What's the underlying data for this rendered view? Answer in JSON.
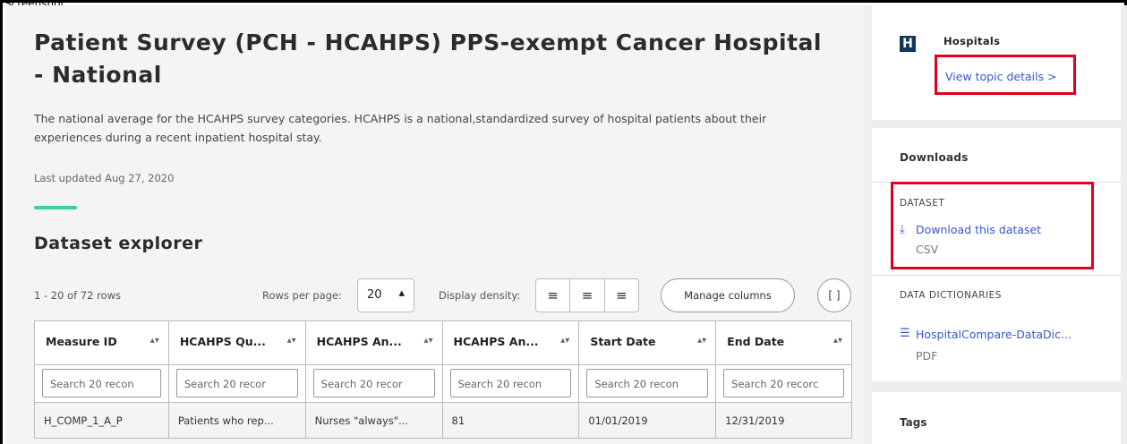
{
  "frame_label": "Screenshot",
  "page": {
    "title": "Patient Survey (PCH - HCAHPS) PPS-exempt Cancer Hospital - National",
    "description": "The national average for the HCAHPS survey categories. HCAHPS is a national,standardized survey of hospital patients about their experiences during a recent inpatient hospital stay.",
    "last_updated": "Last updated Aug 27, 2020"
  },
  "explorer": {
    "title": "Dataset explorer",
    "rows_info": "1 - 20 of 72 rows",
    "rows_per_page_label": "Rows per page:",
    "rows_per_page_value": "20",
    "density_label": "Display density:",
    "manage_columns_label": "Manage columns",
    "columns": [
      "Measure ID",
      "HCAHPS Qu...",
      "HCAHPS An...",
      "HCAHPS An...",
      "Start Date",
      "End Date"
    ],
    "search_placeholders": [
      "Search 20 recon",
      "Search 20 recor",
      "Search 20 recor",
      "Search 20 recon",
      "Search 20 recon",
      "Search 20 recorc"
    ],
    "rows": [
      [
        "H_COMP_1_A_P",
        "Patients who rep...",
        "Nurses \"always\"...",
        "81",
        "01/01/2019",
        "12/31/2019"
      ]
    ]
  },
  "sidebar": {
    "topic_icon_letter": "H",
    "topic_name": "Hospitals",
    "topic_link": "View topic details >",
    "downloads_title": "Downloads",
    "dataset_label": "DATASET",
    "download_link": "Download this dataset",
    "download_format": "CSV",
    "dictionaries_label": "DATA DICTIONARIES",
    "dictionary_link": "HospitalCompare-DataDic...",
    "dictionary_format": "PDF",
    "tags_title": "Tags"
  },
  "colors": {
    "accent_green": "#3ed19a",
    "link_blue": "#3a55c9",
    "highlight_red": "#e0001b",
    "topic_icon_navy": "#12365c"
  }
}
